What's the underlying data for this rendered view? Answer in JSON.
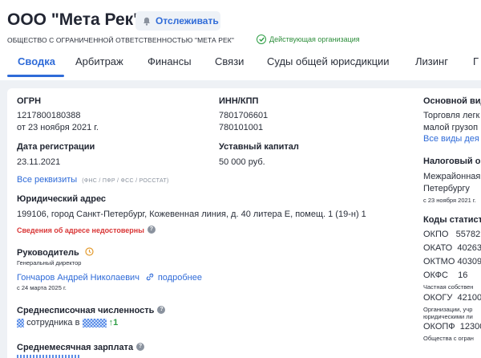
{
  "company": {
    "title": "ООО \"Мета Рек\"",
    "follow_label": "Отслеживать",
    "full_name": "ОБЩЕСТВО С ОГРАНИЧЕННОЙ ОТВЕТСТВЕННОСТЬЮ \"МЕТА РЕК\"",
    "status": "Действующая организация"
  },
  "tabs": [
    "Сводка",
    "Арбитраж",
    "Финансы",
    "Связи",
    "Суды общей юрисдикции",
    "Лизинг",
    "Г"
  ],
  "summary": {
    "ogrn_label": "ОГРН",
    "ogrn_value": "1217800180388",
    "ogrn_date": "от 23 ноября 2021 г.",
    "reg_label": "Дата регистрации",
    "reg_value": "23.11.2021",
    "requisites_link": "Все реквизиты",
    "requisites_tag": "(ФНС / ПФР / ФСС / РОССТАТ)",
    "inn_label": "ИНН/КПП",
    "inn_value": "7801706601",
    "kpp_value": "780101001",
    "capital_label": "Уставный капитал",
    "capital_value": "50 000 руб.",
    "address_label": "Юридический адрес",
    "address_value": "199106, город Санкт-Петербург, Кожевенная линия, д. 40 литера Е, помещ. 1 (19-н) 1",
    "address_warning": "Сведения об адресе недостоверны",
    "head_label": "Руководитель",
    "head_role": "Генеральный директор",
    "head_name": "Гончаров Андрей Николаевич",
    "head_more": "подробнее",
    "head_date": "с 24 марта 2025 г.",
    "staff_label": "Среднесписочная численность",
    "staff_text": "сотрудника в",
    "staff_trend": "↑1",
    "salary_label": "Среднемесячная зарплата"
  },
  "right_column": {
    "activity_label": "Основной вид",
    "activity_line1": "Торговля легк",
    "activity_line2": "малой грузоп",
    "activity_link": "Все виды дея",
    "tax_label": "Налоговый о",
    "tax_line1": "Межрайонная",
    "tax_line2": "Петербургу",
    "tax_date": "с 23 ноября 2021 г.",
    "codes_label": "Коды статист",
    "codes": [
      {
        "name": "ОКПО",
        "value": "55782"
      },
      {
        "name": "ОКАТО",
        "value": "40263"
      },
      {
        "name": "ОКТМО",
        "value": "40309"
      },
      {
        "name": "ОКФС",
        "value": "16"
      }
    ],
    "okfs_desc": "Частная собствен",
    "okogu": {
      "name": "ОКОГУ",
      "value": "42100"
    },
    "okogu_desc1": "Организации, учр",
    "okogu_desc2": "юридическими ли",
    "okopf": {
      "name": "ОКОПФ",
      "value": "12300"
    },
    "okopf_desc": "Общества с огран"
  },
  "colors": {
    "accent": "#2f6bd8",
    "success": "#2e8e3c",
    "danger": "#d93636",
    "clock": "#e39a2d"
  }
}
